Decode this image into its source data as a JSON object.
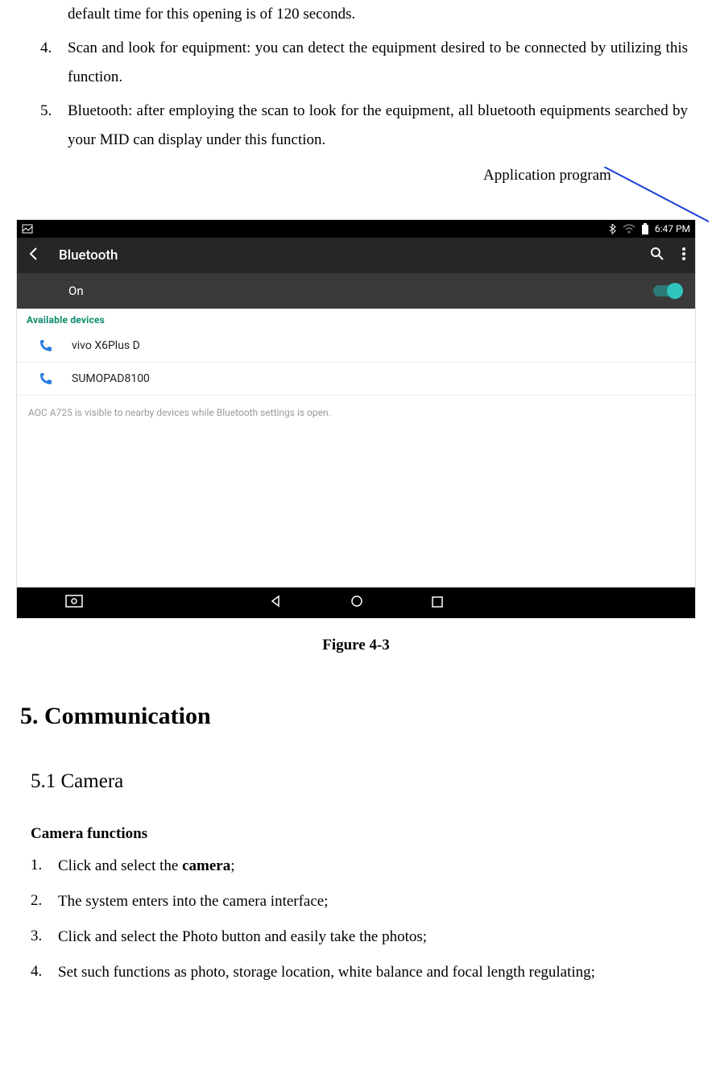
{
  "list_top": {
    "item3_cont": "default time for this opening is of 120 seconds.",
    "n4": "4.",
    "item4": "Scan and look for equipment: you can detect the equipment desired to be connected by utilizing this function.",
    "n5": "5.",
    "item5": "Bluetooth: after employing the scan to look for the equipment, all bluetooth equipments searched by your MID can display under this function."
  },
  "callout": "Application program",
  "screenshot": {
    "time": "6:47 PM",
    "title": "Bluetooth",
    "on_label": "On",
    "available": "Available devices",
    "dev1": "vivo X6Plus D",
    "dev2": "SUMOPAD8100",
    "note": "AOC A725 is visible to nearby devices while Bluetooth settings is open."
  },
  "figure_caption": "Figure 4-3",
  "h1": "5. Communication",
  "h2": "5.1 Camera",
  "camera_sub": "Camera functions",
  "cam": {
    "n1": "1.",
    "t1a": "Click and select the ",
    "t1b": "camera",
    "t1c": ";",
    "n2": "2.",
    "t2": "The system enters into the camera interface;",
    "n3": "3.",
    "t3": "Click and select the Photo button and easily take the photos;",
    "n4": "4.",
    "t4": "Set such functions as photo, storage location, white balance and focal length regulating;"
  }
}
